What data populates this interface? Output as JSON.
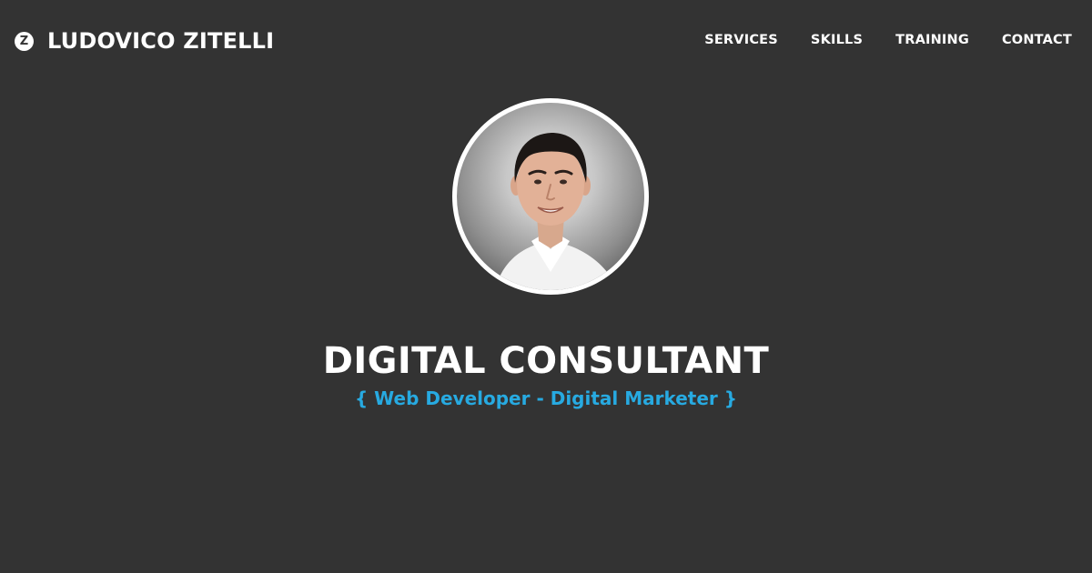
{
  "brand": {
    "icon": "z-logo-icon",
    "icon_letter": "Z",
    "name": "LUDOVICO ZITELLI"
  },
  "nav": {
    "items": [
      {
        "label": "SERVICES"
      },
      {
        "label": "SKILLS"
      },
      {
        "label": "TRAINING"
      },
      {
        "label": "CONTACT"
      }
    ]
  },
  "hero": {
    "photo": "profile-photo",
    "headline": "DIGITAL CONSULTANT",
    "subtitle": "{ Web Developer - Digital Marketer }"
  },
  "colors": {
    "background": "#333333",
    "text": "#ffffff",
    "accent": "#27aae1"
  }
}
